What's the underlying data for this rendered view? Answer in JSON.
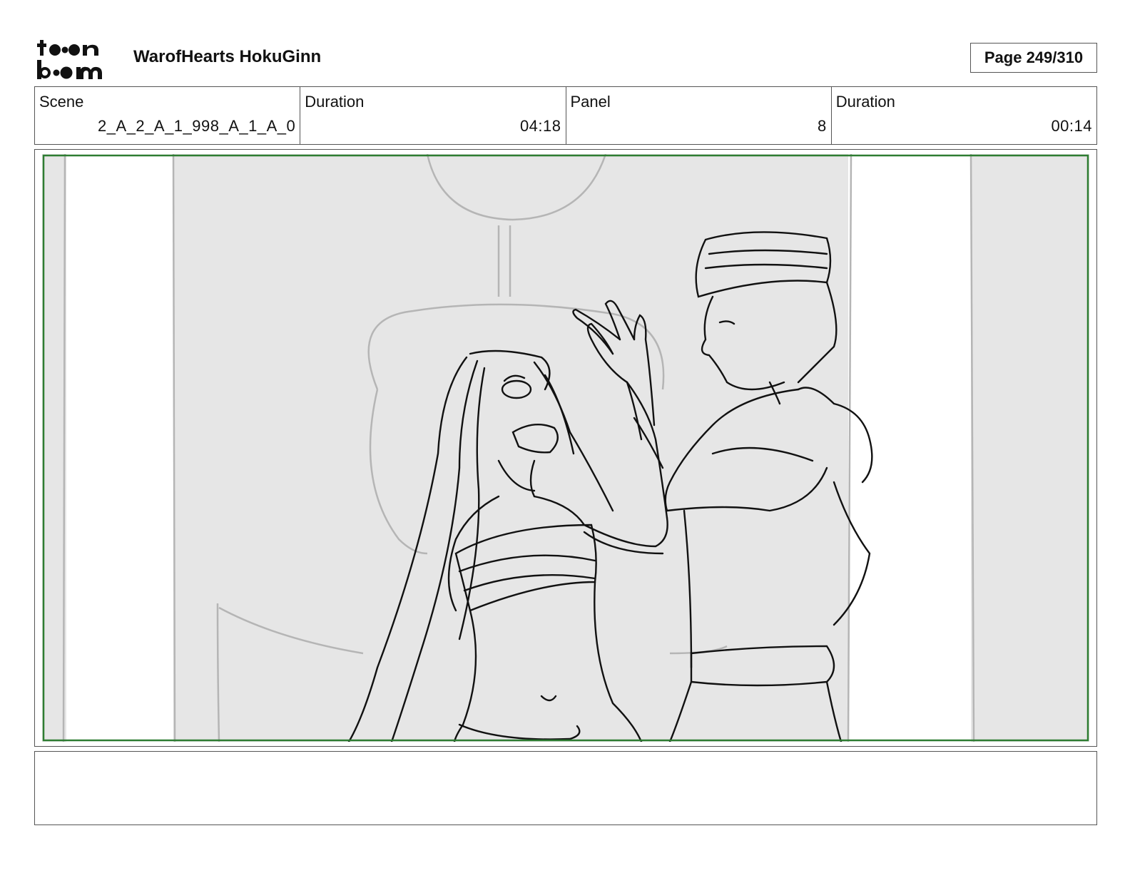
{
  "header": {
    "logo_text": "toon boom",
    "project_title": "WarofHearts HokuGinn",
    "page_label": "Page 249/310"
  },
  "info": {
    "scene_label": "Scene",
    "scene_value": "2_A_2_A_1_998_A_1_A_0",
    "scene_duration_label": "Duration",
    "scene_duration_value": "04:18",
    "panel_label": "Panel",
    "panel_value": "8",
    "panel_duration_label": "Duration",
    "panel_duration_value": "00:14"
  },
  "panel": {
    "safe_frame_color": "#2e7d32",
    "background_color": "#e6e6e6",
    "sketch_line_color": "#111111",
    "bg_line_color": "#b5b5b5"
  },
  "caption": {
    "text": ""
  }
}
